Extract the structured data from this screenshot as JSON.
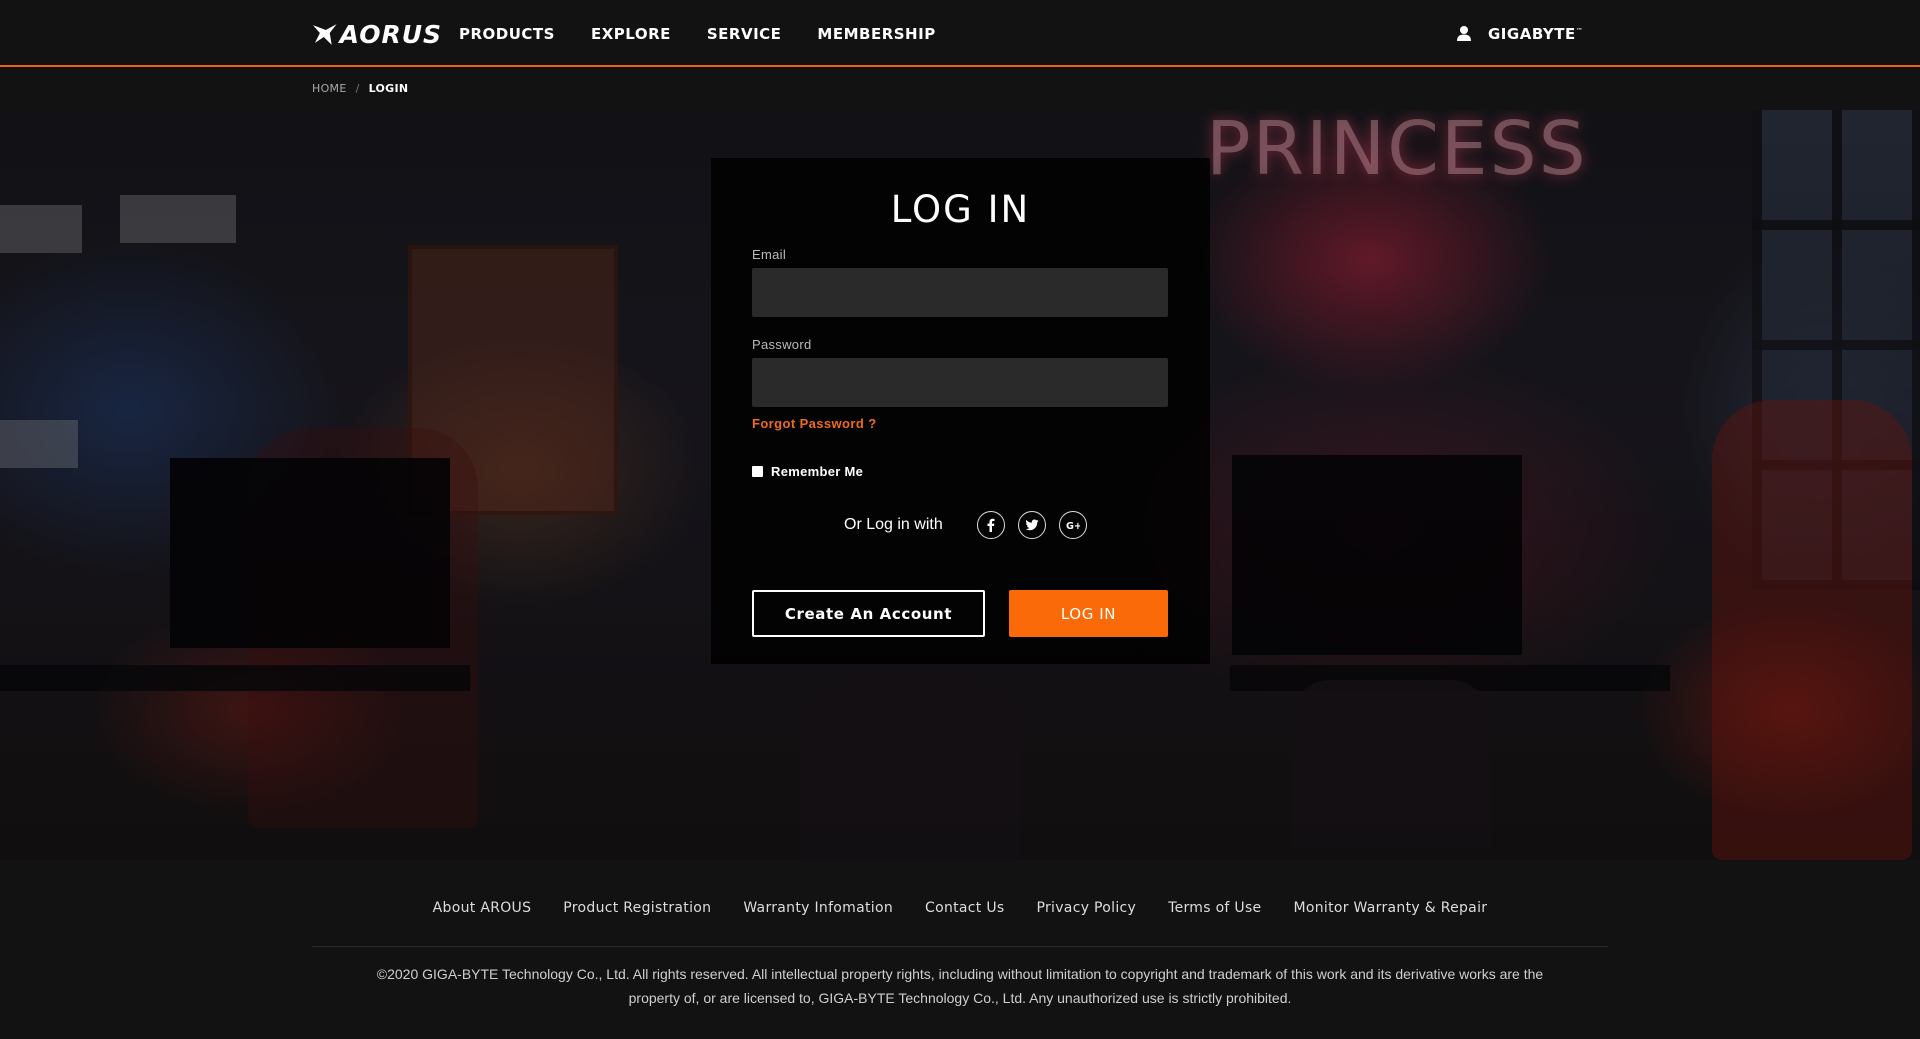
{
  "header": {
    "logo_text": "AORUS",
    "nav": [
      {
        "label": "PRODUCTS"
      },
      {
        "label": "EXPLORE"
      },
      {
        "label": "SERVICE"
      },
      {
        "label": "MEMBERSHIP"
      }
    ],
    "brand": "GIGABYTE",
    "brand_tm": "™",
    "accent_color": "#e8641b"
  },
  "breadcrumb": {
    "home": "HOME",
    "separator": "/",
    "current": "LOGIN"
  },
  "hero": {
    "sign_text": "PRINCESS"
  },
  "login": {
    "title": "LOG IN",
    "email_label": "Email",
    "email_value": "",
    "password_label": "Password",
    "password_value": "",
    "forgot_label": "Forgot Password ?",
    "remember_label": "Remember Me",
    "social_label": "Or Log in with",
    "social_icons": [
      "facebook-icon",
      "twitter-icon",
      "google-plus-icon"
    ],
    "create_account_label": "Create An Account",
    "login_button_label": "LOG IN",
    "login_button_color": "#fb6a08",
    "forgot_color": "#f06a1c"
  },
  "footer": {
    "links": [
      {
        "label": "About AROUS"
      },
      {
        "label": "Product Registration"
      },
      {
        "label": "Warranty Infomation"
      },
      {
        "label": "Contact Us"
      },
      {
        "label": "Privacy Policy"
      },
      {
        "label": "Terms of Use"
      },
      {
        "label": "Monitor Warranty & Repair"
      }
    ],
    "copyright_line1": "©2020 GIGA-BYTE Technology Co., Ltd. All rights reserved. All intellectual property rights, including without limitation to copyright and trademark of this work and its derivative works are the",
    "copyright_line2": "property of, or are licensed to, GIGA-BYTE Technology Co., Ltd. Any unauthorized use is strictly prohibited."
  }
}
